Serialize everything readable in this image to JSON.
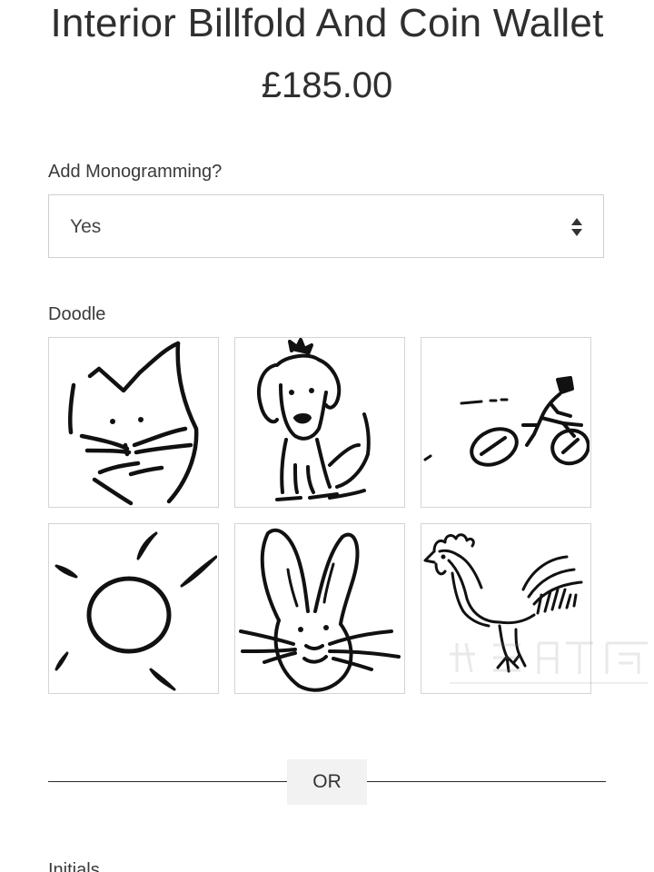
{
  "product": {
    "title": "Interior Billfold And Coin Wallet",
    "price": "£185.00"
  },
  "monogramming": {
    "label": "Add Monogramming?",
    "selected": "Yes"
  },
  "doodle": {
    "label": "Doodle",
    "options": [
      "cat",
      "dog",
      "cyclist",
      "sun",
      "rabbit",
      "rooster"
    ]
  },
  "divider": {
    "text": "OR"
  },
  "initials": {
    "label": "Initials"
  }
}
